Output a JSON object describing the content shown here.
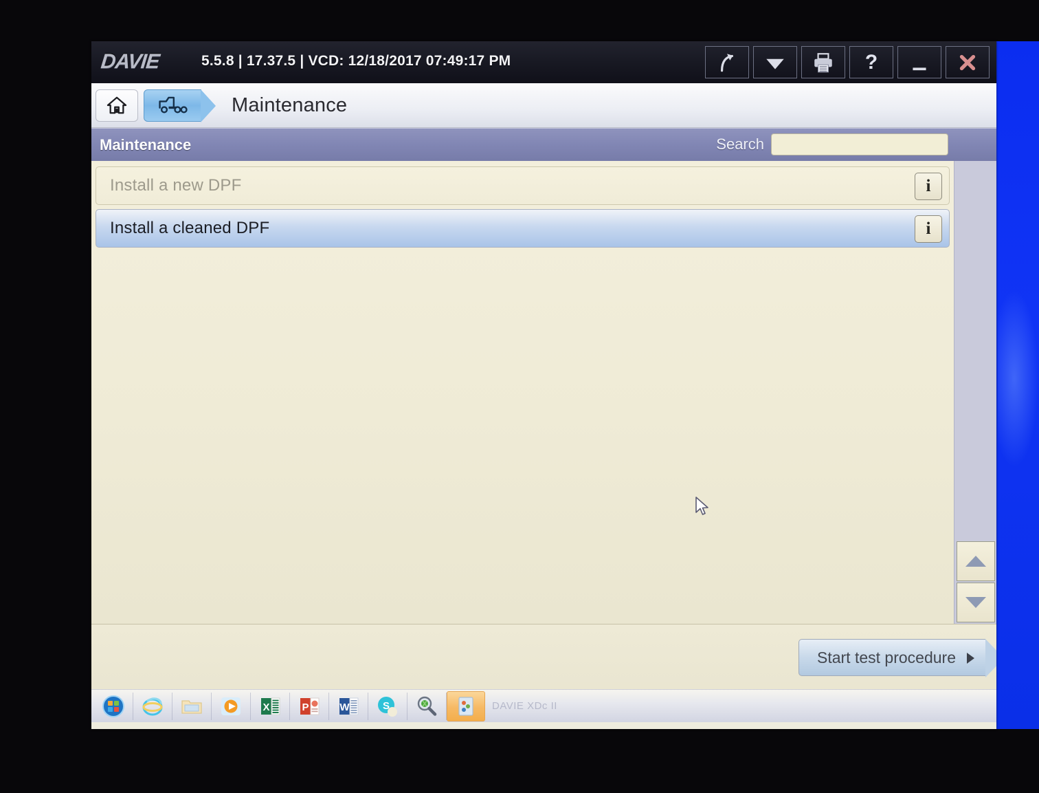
{
  "titlebar": {
    "logo": "DAVIE",
    "version_info": "5.5.8 | 17.37.5 | VCD: 12/18/2017 07:49:17 PM",
    "tools": [
      {
        "name": "forward-arrow-icon",
        "label": "Forward"
      },
      {
        "name": "dropdown-arrow-icon",
        "label": "More"
      },
      {
        "name": "printer-icon",
        "label": "Print"
      },
      {
        "name": "help-icon",
        "label": "?"
      },
      {
        "name": "minimize-icon",
        "label": "Minimize"
      },
      {
        "name": "close-icon",
        "label": "Close"
      }
    ]
  },
  "breadcrumb": {
    "home_label": "Home",
    "vehicle_tab_label": "Vehicle",
    "title": "Maintenance"
  },
  "section": {
    "title": "Maintenance",
    "search_label": "Search",
    "search_value": "",
    "search_placeholder": ""
  },
  "list": {
    "rows": [
      {
        "label": "Install a new DPF",
        "state": "disabled",
        "info_label": "i"
      },
      {
        "label": "Install a cleaned DPF",
        "state": "selected",
        "info_label": "i"
      }
    ]
  },
  "scroll": {
    "up_label": "Scroll up",
    "down_label": "Scroll down"
  },
  "footer": {
    "start_label": "Start test procedure"
  },
  "taskbar": {
    "start_label": "Start",
    "items": [
      {
        "name": "taskbar-start-orb",
        "label": "Start"
      },
      {
        "name": "taskbar-internet-explorer-icon",
        "label": "Internet Explorer"
      },
      {
        "name": "taskbar-file-explorer-icon",
        "label": "File Explorer"
      },
      {
        "name": "taskbar-media-player-icon",
        "label": "Windows Media Player"
      },
      {
        "name": "taskbar-excel-icon",
        "label": "Excel"
      },
      {
        "name": "taskbar-powerpoint-icon",
        "label": "PowerPoint"
      },
      {
        "name": "taskbar-word-icon",
        "label": "Word"
      },
      {
        "name": "taskbar-skype-icon",
        "label": "Skype"
      },
      {
        "name": "taskbar-magnifier-icon",
        "label": "Search"
      },
      {
        "name": "taskbar-davie-icon",
        "label": "DAVIE"
      }
    ],
    "active_window_text": "DAVIE XDc II"
  },
  "colors": {
    "titlebar_bg": "#191a24",
    "section_header": "#8186b4",
    "content_bg": "#f0ecd8",
    "selection_blue": "#a9c4e8",
    "desktop_blue": "#1034f5",
    "accent_tab": "#7db8e8"
  }
}
